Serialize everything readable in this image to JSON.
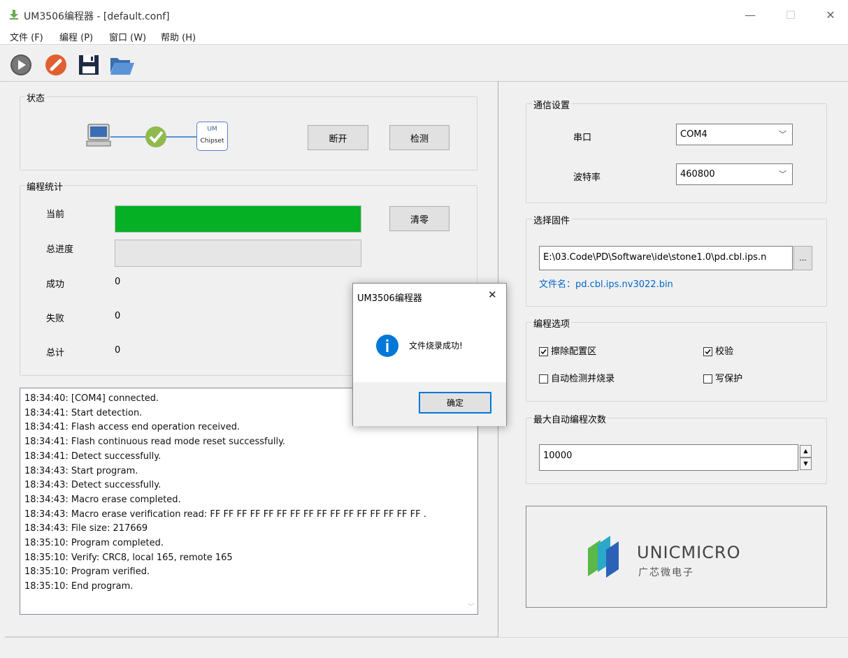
{
  "window": {
    "title": "UM3506编程器 - [default.conf]",
    "minimize": "—",
    "maximize": "☐",
    "close": "✕"
  },
  "menu": {
    "items": [
      "文件 (F)",
      "编程 (P)",
      "窗口 (W)",
      "帮助 (H)"
    ]
  },
  "toolbar": {
    "icons": [
      "start-icon",
      "stop-icon",
      "save-icon",
      "open-folder-icon"
    ]
  },
  "status_group": {
    "label": "状态",
    "chip_top": "UM",
    "chip_bottom": "Chipset",
    "disconnect_button": "断开",
    "detect_button": "检测"
  },
  "stats_group": {
    "label": "编程统计",
    "current_label": "当前",
    "current_progress": 1.0,
    "total_progress_label": "总进度",
    "total_progress": 0.0,
    "clear_button": "清零",
    "success_label": "成功",
    "success_value": "0",
    "fail_label": "失败",
    "fail_value": "0",
    "total_label": "总计",
    "total_value": "0"
  },
  "log": {
    "lines": [
      "18:34:40: [COM4] connected.",
      "18:34:41: Start detection.",
      "18:34:41: Flash access end operation received.",
      "18:34:41: Flash continuous read mode reset successfully.",
      "18:34:41: Detect successfully.",
      "18:34:43: Start program.",
      "18:34:43: Detect successfully.",
      "18:34:43: Macro erase completed.",
      "18:34:43: Macro erase verification read: FF FF FF FF FF FF FF FF FF FF FF FF FF FF FF FF .",
      "18:34:43: File size: 217669",
      "18:35:10: Program completed.",
      "18:35:10: Verify: CRC8, local 165, remote 165",
      "18:35:10: Program verified.",
      "18:35:10: End program."
    ]
  },
  "comm_group": {
    "label": "通信设置",
    "port_label": "串口",
    "port_value": "COM4",
    "baud_label": "波特率",
    "baud_value": "460800"
  },
  "firmware_group": {
    "label": "选择固件",
    "path_value": "E:\\03.Code\\PD\\Software\\ide\\stone1.0\\pd.cbl.ips.n",
    "browse_button": "...",
    "filename_text": "文件名：pd.cbl.ips.nv3022.bin"
  },
  "options_group": {
    "label": "编程选项",
    "erase_config": "擦除配置区",
    "erase_config_checked": true,
    "verify": "校验",
    "verify_checked": true,
    "auto_detect": "自动检测并烧录",
    "auto_detect_checked": false,
    "write_protect": "写保护",
    "write_protect_checked": false
  },
  "max_group": {
    "label": "最大自动编程次数",
    "value": "10000"
  },
  "logo": {
    "name": "UNICMICRO",
    "subtitle": "广芯微电子"
  },
  "dialog": {
    "title": "UM3506编程器",
    "close": "✕",
    "message": "文件烧录成功!",
    "ok_button": "确定"
  },
  "colors": {
    "progress_green": "#06b025",
    "link_blue": "#0066cc",
    "info_blue": "#0078d7"
  }
}
